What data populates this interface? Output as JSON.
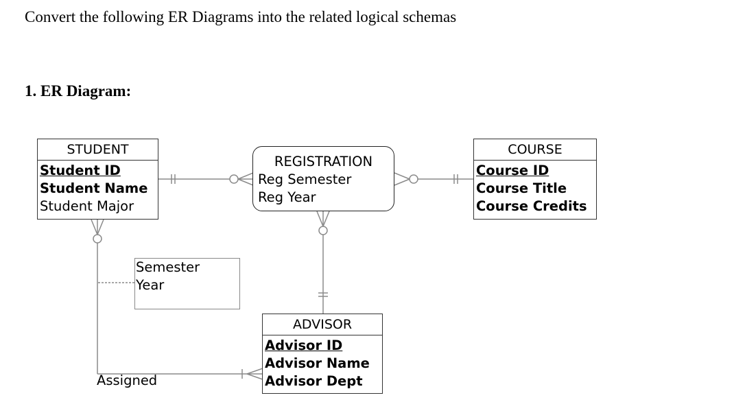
{
  "document": {
    "instruction": "Convert the following ER Diagrams into the related logical schemas",
    "section_heading": "1. ER Diagram:"
  },
  "diagram": {
    "entities": {
      "student": {
        "name": "STUDENT",
        "attributes": [
          {
            "label": "Student ID",
            "role": "primary-key"
          },
          {
            "label": "Student Name",
            "role": "required"
          },
          {
            "label": "Student Major",
            "role": "optional"
          }
        ]
      },
      "registration": {
        "name": "REGISTRATION",
        "kind": "associative-entity",
        "attributes": [
          {
            "label": "Reg Semester",
            "role": "optional"
          },
          {
            "label": "Reg Year",
            "role": "optional"
          }
        ]
      },
      "course": {
        "name": "COURSE",
        "attributes": [
          {
            "label": "Course ID",
            "role": "primary-key"
          },
          {
            "label": "Course Title",
            "role": "required"
          },
          {
            "label": "Course Credits",
            "role": "required"
          }
        ]
      },
      "advisor": {
        "name": "ADVISOR",
        "attributes": [
          {
            "label": "Advisor ID",
            "role": "primary-key"
          },
          {
            "label": "Advisor Name",
            "role": "required"
          },
          {
            "label": "Advisor Dept",
            "role": "required"
          }
        ]
      }
    },
    "relationships": [
      {
        "from": "STUDENT",
        "from_cardinality": "mandatory-one",
        "to": "REGISTRATION",
        "to_cardinality": "optional-many"
      },
      {
        "from": "COURSE",
        "from_cardinality": "mandatory-one",
        "to": "REGISTRATION",
        "to_cardinality": "optional-many"
      },
      {
        "from": "ADVISOR",
        "from_cardinality": "mandatory-one",
        "to": "REGISTRATION",
        "to_cardinality": "optional-many"
      },
      {
        "name": "Assigned",
        "from": "STUDENT",
        "from_cardinality": "optional-many",
        "to": "ADVISOR",
        "to_cardinality": "mandatory-many",
        "attributes": [
          "Semester",
          "Year"
        ]
      }
    ],
    "relationship_attribute_box": [
      "Semester",
      "Year"
    ],
    "relationship_label": "Assigned",
    "colors": {
      "connector": "#8a8a8a",
      "border": "#333333",
      "text": "#000000"
    }
  }
}
